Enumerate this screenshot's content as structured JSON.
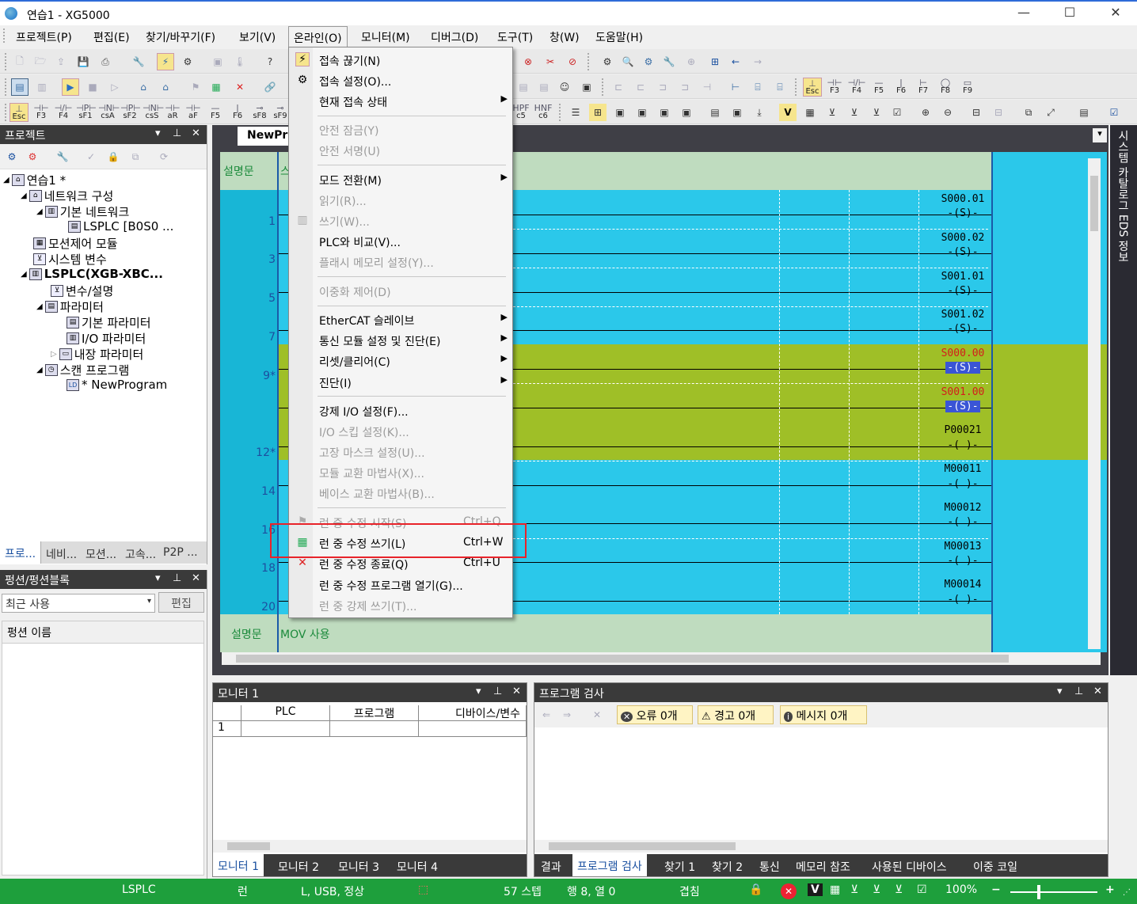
{
  "window": {
    "title": "연습1 - XG5000",
    "minimize": "—",
    "maximize": "☐",
    "close": "✕"
  },
  "menubar": [
    "프로젝트(P)",
    "편집(E)",
    "찾기/바꾸기(F)",
    "보기(V)",
    "온라인(O)",
    "모니터(M)",
    "디버그(D)",
    "도구(T)",
    "창(W)",
    "도움말(H)"
  ],
  "fkeys_row2": [
    "F3",
    "F4",
    "F5",
    "F6",
    "F7",
    "F8",
    "F9"
  ],
  "fkeys_row3a": [
    "F3",
    "F4",
    "sF1",
    "csA",
    "sF2",
    "csS",
    "aR",
    "aF",
    "F5",
    "F6",
    "sF8",
    "sF9"
  ],
  "fkeys_row3b": [
    "c5",
    "c6"
  ],
  "esc": "Esc",
  "project_panel": {
    "title": "프로젝트",
    "tree": [
      {
        "label": "연습1 *",
        "bold": false
      },
      {
        "label": "네트워크 구성"
      },
      {
        "label": "기본 네트워크"
      },
      {
        "label": "LSPLC [B0S0 ..."
      },
      {
        "label": "모션제어 모듈"
      },
      {
        "label": "시스템 변수"
      },
      {
        "label": "LSPLC(XGB-XBC...",
        "bold": true
      },
      {
        "label": "변수/설명"
      },
      {
        "label": "파라미터"
      },
      {
        "label": "기본 파라미터"
      },
      {
        "label": "I/O 파라미터"
      },
      {
        "label": "내장 파라미터"
      },
      {
        "label": "스캔 프로그램"
      },
      {
        "label": "* NewProgram"
      }
    ],
    "tabs": [
      "프로...",
      "네비...",
      "모션...",
      "고속...",
      "P2P ..."
    ]
  },
  "func_panel": {
    "title": "펑션/펑션블록",
    "recent": "최근 사용",
    "edit_button": "편집",
    "column": "펑션 이름"
  },
  "editor": {
    "tab": "NewPr",
    "side_tab": "시스템 카탈로그 EDS 정보",
    "desc_label": "설명문",
    "desc_top_visible": "스",
    "desc_bottom": "MOV 사용",
    "rows": [
      {
        "num": "1",
        "coil": "S000.01",
        "sym": "‑(S)‑",
        "color": "cyan"
      },
      {
        "num": "3",
        "coil": "S000.02",
        "sym": "‑(S)‑",
        "color": "cyan"
      },
      {
        "num": "5",
        "coil": "S001.01",
        "sym": "‑(S)‑",
        "color": "cyan"
      },
      {
        "num": "7",
        "coil": "S001.02",
        "sym": "‑(S)‑",
        "color": "cyan"
      },
      {
        "num": "9*",
        "coil": "S000.00",
        "sym": "‑(S)‑",
        "color": "green",
        "coil_red": true
      },
      {
        "num": "",
        "coil": "S001.00",
        "sym": "‑(S)‑",
        "color": "green",
        "coil_red": true
      },
      {
        "num": "12*",
        "coil": "P00021",
        "sym": "‑( )‑",
        "color": "green"
      },
      {
        "num": "14",
        "coil": "M00011",
        "sym": "‑( )‑",
        "color": "cyan"
      },
      {
        "num": "16",
        "coil": "M00012",
        "sym": "‑( )‑",
        "color": "cyan"
      },
      {
        "num": "18",
        "coil": "M00013",
        "sym": "‑( )‑",
        "color": "cyan"
      },
      {
        "num": "20",
        "coil": "M00014",
        "sym": "‑( )‑",
        "color": "cyan"
      }
    ]
  },
  "online_menu": {
    "items": [
      {
        "label": "접속 끊기(N)",
        "enabled": true,
        "icon": "disconnect-icon"
      },
      {
        "label": "접속 설정(O)...",
        "enabled": true,
        "icon": "connection-settings-icon"
      },
      {
        "label": "현재 접속 상태",
        "enabled": true,
        "submenu": true
      },
      {
        "sep": true
      },
      {
        "label": "안전 잠금(Y)",
        "enabled": false
      },
      {
        "label": "안전 서명(U)",
        "enabled": false
      },
      {
        "sep": true
      },
      {
        "label": "모드 전환(M)",
        "enabled": true,
        "submenu": true
      },
      {
        "label": "읽기(R)...",
        "enabled": false
      },
      {
        "label": "쓰기(W)...",
        "enabled": false,
        "icon": "write-icon"
      },
      {
        "label": "PLC와 비교(V)...",
        "enabled": true
      },
      {
        "label": "플래시 메모리 설정(Y)...",
        "enabled": false
      },
      {
        "sep": true
      },
      {
        "label": "이중화 제어(D)",
        "enabled": false
      },
      {
        "sep": true
      },
      {
        "label": "EtherCAT 슬레이브",
        "enabled": true,
        "submenu": true
      },
      {
        "label": "통신 모듈 설정 및 진단(E)",
        "enabled": true,
        "submenu": true
      },
      {
        "label": "리셋/클리어(C)",
        "enabled": true,
        "submenu": true
      },
      {
        "label": "진단(I)",
        "enabled": true,
        "submenu": true
      },
      {
        "sep": true
      },
      {
        "label": "강제 I/O 설정(F)...",
        "enabled": true
      },
      {
        "label": "I/O 스킵 설정(K)...",
        "enabled": false
      },
      {
        "label": "고장 마스크 설정(U)...",
        "enabled": false
      },
      {
        "label": "모듈 교환 마법사(X)...",
        "enabled": false
      },
      {
        "label": "베이스 교환 마법사(B)...",
        "enabled": false
      },
      {
        "sep": true
      },
      {
        "label": "런 중 수정 시작(S)",
        "enabled": false,
        "shortcut": "Ctrl+Q",
        "icon": "run-edit-start-icon"
      },
      {
        "label": "런 중 수정 쓰기(L)",
        "enabled": true,
        "shortcut": "Ctrl+W",
        "icon": "run-edit-write-icon",
        "highlighted": true
      },
      {
        "label": "런 중 수정 종료(Q)",
        "enabled": true,
        "shortcut": "Ctrl+U",
        "icon": "run-edit-end-icon"
      },
      {
        "label": "런 중 수정 프로그램 열기(G)...",
        "enabled": true
      },
      {
        "label": "런 중 강제 쓰기(T)...",
        "enabled": false
      }
    ]
  },
  "monitor": {
    "title": "모니터 1",
    "columns": [
      "PLC",
      "프로그램",
      "디바이스/변수"
    ],
    "row1": "1",
    "tabs": [
      "모니터 1",
      "모니터 2",
      "모니터 3",
      "모니터 4"
    ]
  },
  "program_check": {
    "title": "프로그램 검사",
    "errors": "오류 0개",
    "warnings": "경고 0개",
    "messages": "메시지 0개",
    "tabs": [
      "결과",
      "프로그램 검사",
      "찾기 1",
      "찾기 2",
      "통신",
      "메모리 참조",
      "사용된 디바이스",
      "이중 코일"
    ]
  },
  "status": {
    "plc": "LSPLC",
    "mode": "런",
    "connection": "L, USB, 정상",
    "steps": "57 스텝",
    "position": "행 8, 열 0",
    "overwrite": "겹침",
    "zoom": "100%",
    "bar_color": "#1e9f3c"
  },
  "colors": {
    "ladder_bg": "#2bc8ea",
    "ladder_row_sel": "#9fbf27",
    "desc_row": "#bfdcbf",
    "highlight_box": "#e8232a"
  }
}
